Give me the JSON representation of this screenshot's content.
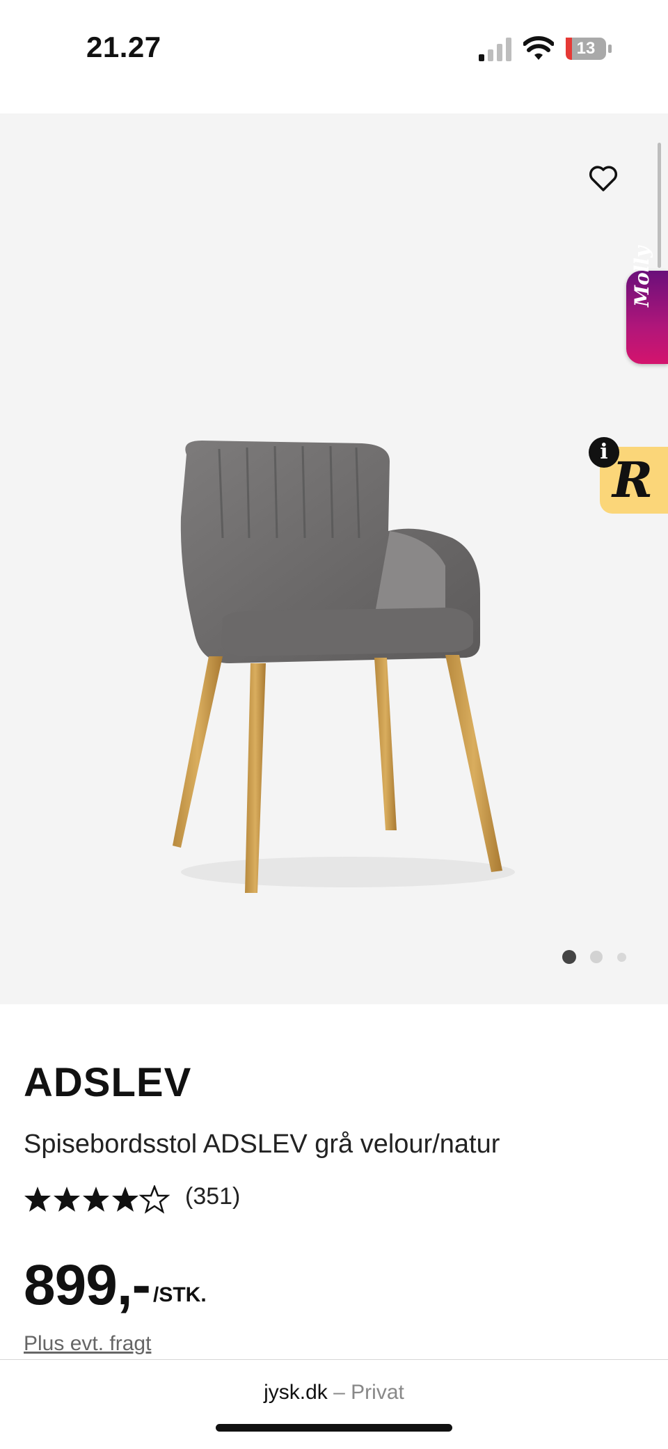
{
  "status_bar": {
    "time": "21.27",
    "battery": "13"
  },
  "product": {
    "brand": "ADSLEV",
    "name": "Spisebordsstol ADSLEV grå velour/natur",
    "rating": 4.5,
    "rating_count": "(351)",
    "price": "899,-",
    "unit": "/STK.",
    "freight_link": "Plus evt. fragt"
  },
  "gallery": {
    "image_count": 3,
    "active_index": 0,
    "molly_label": "Molly",
    "review_badge_letter": "R",
    "info_glyph": "i"
  },
  "browser": {
    "domain": "jysk.dk",
    "separator": " – ",
    "mode": "Privat"
  },
  "colors": {
    "gallery_bg": "#f4f4f4",
    "molly_gradient_top": "#6a0f7a",
    "molly_gradient_bottom": "#d4146d",
    "review_badge": "#fbd679",
    "battery_low": "#e53935"
  },
  "icons": [
    "signal-icon",
    "wifi-icon",
    "battery-icon",
    "heart-icon",
    "info-icon",
    "star-icon"
  ]
}
